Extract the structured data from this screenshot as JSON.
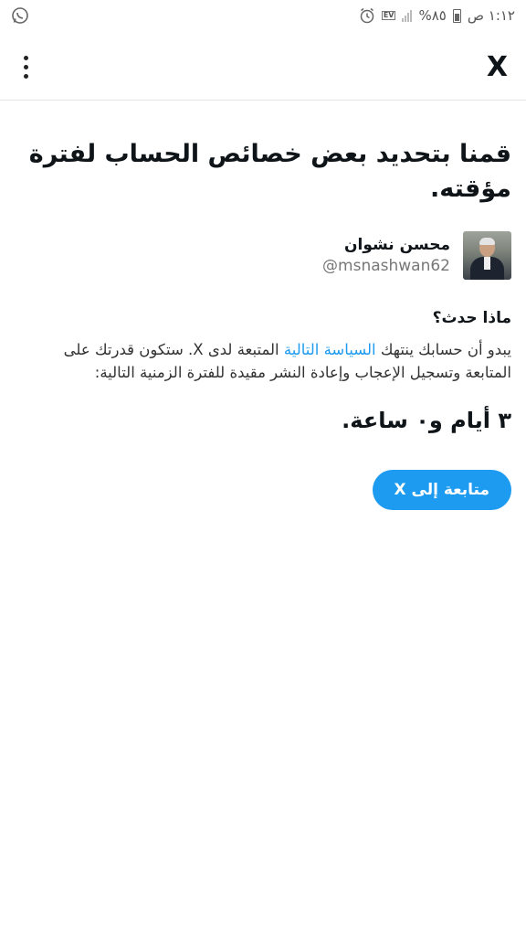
{
  "status_bar": {
    "time": "١:١٢ ص",
    "battery": "٨٥%",
    "network_badge": "EV",
    "icons": [
      "alarm-icon",
      "signal-icon",
      "battery-icon",
      "whatsapp-icon"
    ]
  },
  "app_bar": {
    "logo": "X",
    "menu_icon": "more-vertical-icon"
  },
  "notice": {
    "title": "قمنا بتحديد بعض خصائص الحساب لفترة مؤقته.",
    "user": {
      "name": "محسن نشوان",
      "handle": "@msnashwan62"
    },
    "section_title": "ماذا حدث؟",
    "body_before_link": "يبدو أن حسابك ينتهك ",
    "link_text": "السياسة التالية",
    "body_after_link": " المتبعة لدى X. ستكون قدرتك على المتابعة وتسجيل الإعجاب وإعادة النشر مقيدة للفترة الزمنية التالية:",
    "duration": "٣ أيام و٠ ساعة.",
    "cta_label": "متابعة إلى X"
  },
  "colors": {
    "accent": "#1d9bf0",
    "text": "#0f1419",
    "muted": "#777777"
  }
}
